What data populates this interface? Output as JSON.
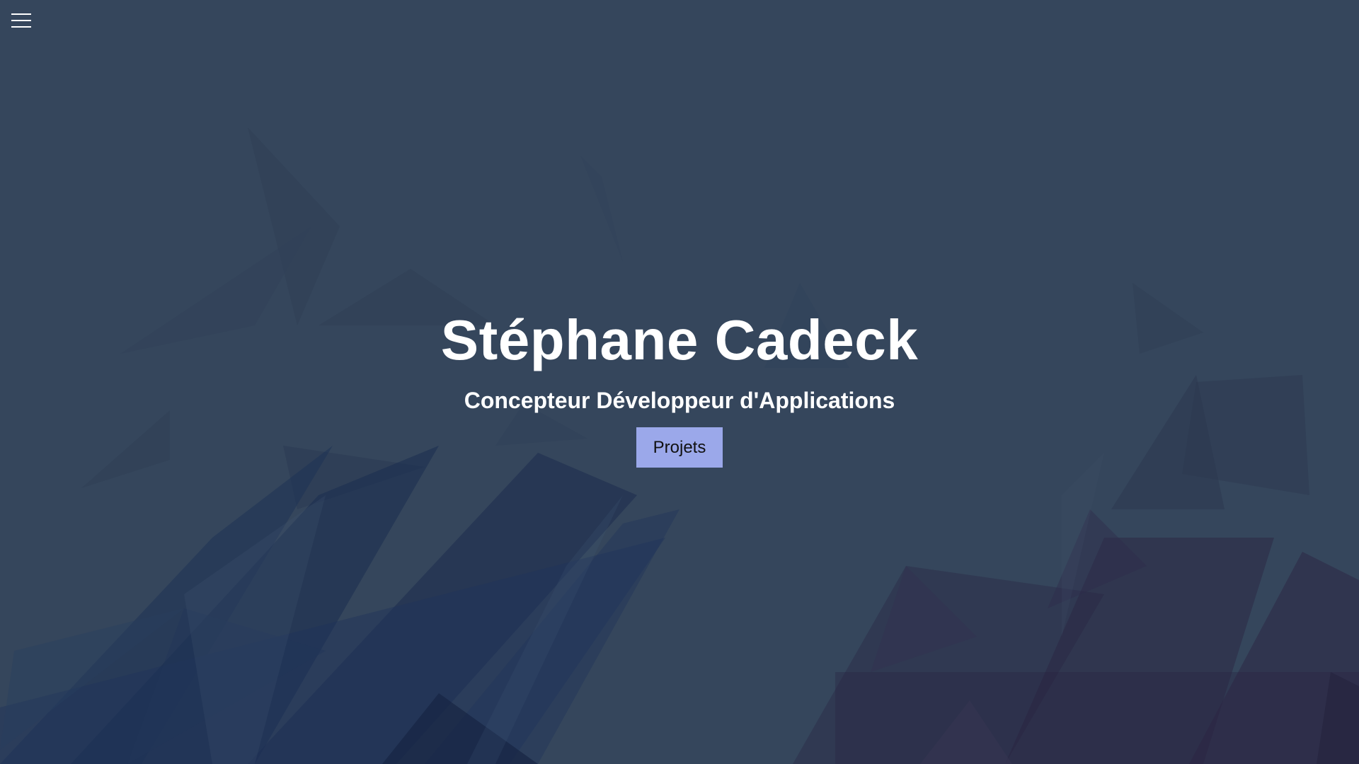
{
  "nav": {
    "menu_icon": "hamburger-menu-icon"
  },
  "hero": {
    "title": "Stéphane Cadeck",
    "subtitle": "Concepteur Développeur d'Applications",
    "button_label": "Projets"
  },
  "colors": {
    "background": "#35465c",
    "button": "#9ba8ea",
    "text": "#ffffff"
  }
}
